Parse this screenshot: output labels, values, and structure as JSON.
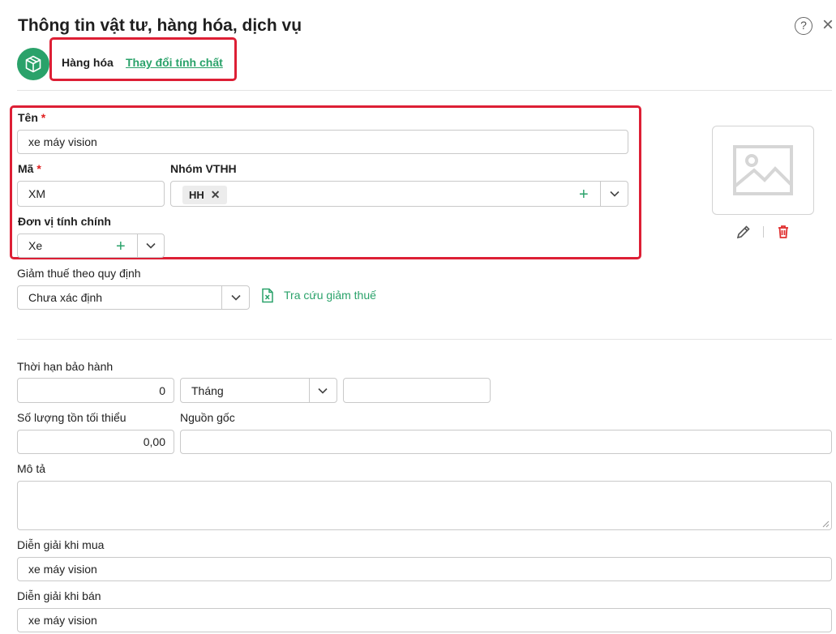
{
  "dialog": {
    "title": "Thông tin vật tư, hàng hóa, dịch vụ",
    "help_glyph": "?",
    "close_glyph": "×"
  },
  "item_type": {
    "label": "Hàng hóa",
    "change_link": "Thay đổi tính chất",
    "icon": "box-icon"
  },
  "fields": {
    "name_label": "Tên",
    "name_value": "xe máy vision",
    "code_label": "Mã",
    "code_value": "XM",
    "group_label": "Nhóm VTHH",
    "group_tags": [
      "HH"
    ],
    "unit_label": "Đơn vị tính chính",
    "unit_value": "Xe",
    "required_mark": "*",
    "tax_label": "Giảm thuế theo quy định",
    "tax_value": "Chưa xác định",
    "tax_lookup_link": "Tra cứu giảm thuế",
    "warranty_label": "Thời hạn bảo hành",
    "warranty_value": "0",
    "warranty_unit": "Tháng",
    "warranty_extra": "",
    "min_stock_label": "Số lượng tồn tối thiểu",
    "min_stock_value": "0,00",
    "origin_label": "Nguồn gốc",
    "origin_value": "",
    "description_label": "Mô tả",
    "description_value": "",
    "purchase_desc_label": "Diễn giải khi mua",
    "purchase_desc_value": "xe máy vision",
    "sale_desc_label": "Diễn giải khi bán",
    "sale_desc_value": "xe máy vision"
  },
  "colors": {
    "accent": "#2aa26a",
    "highlight_box": "#dd1f35",
    "delete": "#e03030"
  }
}
